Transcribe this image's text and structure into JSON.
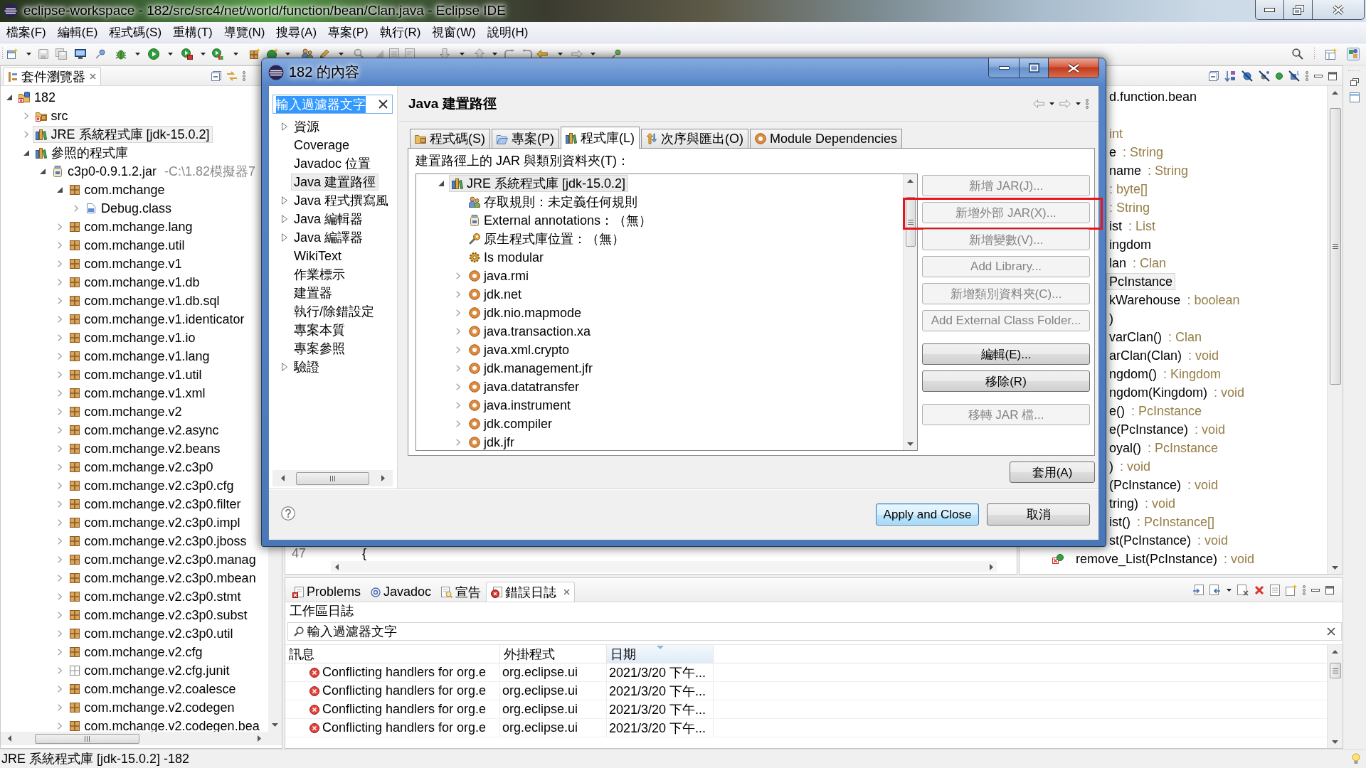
{
  "window": {
    "title": "eclipse-workspace - 182/src/src4/net/world/function/bean/Clan.java - Eclipse IDE"
  },
  "menu_bar": [
    "檔案(F)",
    "編輯(E)",
    "程式碼(S)",
    "重構(T)",
    "導覽(N)",
    "搜尋(A)",
    "專案(P)",
    "執行(R)",
    "視窗(W)",
    "說明(H)"
  ],
  "package_explorer": {
    "title": "套件瀏覽器",
    "tree": [
      {
        "label": "182",
        "kind": "project",
        "expanded": true,
        "selected": false,
        "children": [
          {
            "label": "src",
            "kind": "source-folder",
            "expanded": false,
            "selected": false
          },
          {
            "label": "JRE 系統程式庫 [jdk-15.0.2]",
            "kind": "library",
            "expanded": false,
            "selected": true
          },
          {
            "label": "參照的程式庫",
            "kind": "library",
            "expanded": true,
            "selected": false,
            "children": [
              {
                "label": "c3p0-0.9.1.2.jar",
                "detail": "-C:\\1.82模擬器7",
                "kind": "jar",
                "expanded": true,
                "selected": false,
                "children": [
                  {
                    "label": "com.mchange",
                    "kind": "package",
                    "expanded": true,
                    "selected": false,
                    "children": [
                      {
                        "label": "Debug.class",
                        "kind": "class-file",
                        "expanded": false,
                        "selected": false
                      }
                    ]
                  },
                  {
                    "label": "com.mchange.lang",
                    "kind": "package",
                    "expanded": false,
                    "selected": false
                  },
                  {
                    "label": "com.mchange.util",
                    "kind": "package",
                    "expanded": false,
                    "selected": false
                  },
                  {
                    "label": "com.mchange.v1",
                    "kind": "package",
                    "expanded": false,
                    "selected": false
                  },
                  {
                    "label": "com.mchange.v1.db",
                    "kind": "package",
                    "expanded": false,
                    "selected": false
                  },
                  {
                    "label": "com.mchange.v1.db.sql",
                    "kind": "package",
                    "expanded": false,
                    "selected": false
                  },
                  {
                    "label": "com.mchange.v1.identicator",
                    "kind": "package",
                    "expanded": false,
                    "selected": false
                  },
                  {
                    "label": "com.mchange.v1.io",
                    "kind": "package",
                    "expanded": false,
                    "selected": false
                  },
                  {
                    "label": "com.mchange.v1.lang",
                    "kind": "package",
                    "expanded": false,
                    "selected": false
                  },
                  {
                    "label": "com.mchange.v1.util",
                    "kind": "package",
                    "expanded": false,
                    "selected": false
                  },
                  {
                    "label": "com.mchange.v1.xml",
                    "kind": "package",
                    "expanded": false,
                    "selected": false
                  },
                  {
                    "label": "com.mchange.v2",
                    "kind": "package",
                    "expanded": false,
                    "selected": false
                  },
                  {
                    "label": "com.mchange.v2.async",
                    "kind": "package",
                    "expanded": false,
                    "selected": false
                  },
                  {
                    "label": "com.mchange.v2.beans",
                    "kind": "package",
                    "expanded": false,
                    "selected": false
                  },
                  {
                    "label": "com.mchange.v2.c3p0",
                    "kind": "package",
                    "expanded": false,
                    "selected": false
                  },
                  {
                    "label": "com.mchange.v2.c3p0.cfg",
                    "kind": "package",
                    "expanded": false,
                    "selected": false
                  },
                  {
                    "label": "com.mchange.v2.c3p0.filter",
                    "kind": "package",
                    "expanded": false,
                    "selected": false
                  },
                  {
                    "label": "com.mchange.v2.c3p0.impl",
                    "kind": "package",
                    "expanded": false,
                    "selected": false
                  },
                  {
                    "label": "com.mchange.v2.c3p0.jboss",
                    "kind": "package",
                    "expanded": false,
                    "selected": false
                  },
                  {
                    "label": "com.mchange.v2.c3p0.manag",
                    "kind": "package",
                    "expanded": false,
                    "selected": false
                  },
                  {
                    "label": "com.mchange.v2.c3p0.mbean",
                    "kind": "package",
                    "expanded": false,
                    "selected": false
                  },
                  {
                    "label": "com.mchange.v2.c3p0.stmt",
                    "kind": "package",
                    "expanded": false,
                    "selected": false
                  },
                  {
                    "label": "com.mchange.v2.c3p0.subst",
                    "kind": "package",
                    "expanded": false,
                    "selected": false
                  },
                  {
                    "label": "com.mchange.v2.c3p0.util",
                    "kind": "package",
                    "expanded": false,
                    "selected": false
                  },
                  {
                    "label": "com.mchange.v2.cfg",
                    "kind": "package",
                    "expanded": false,
                    "selected": false
                  },
                  {
                    "label": "com.mchange.v2.cfg.junit",
                    "kind": "empty-package",
                    "expanded": false,
                    "selected": false
                  },
                  {
                    "label": "com.mchange.v2.coalesce",
                    "kind": "package",
                    "expanded": false,
                    "selected": false
                  },
                  {
                    "label": "com.mchange.v2.codegen",
                    "kind": "package",
                    "expanded": false,
                    "selected": false
                  },
                  {
                    "label": "com.mchange.v2.codegen.bea",
                    "kind": "package",
                    "expanded": false,
                    "selected": false
                  }
                ]
              }
            ]
          }
        ]
      }
    ]
  },
  "properties_dialog": {
    "title": "182 的內容",
    "filter": {
      "value": "輸入過濾器文字",
      "value_selected": true
    },
    "categories": [
      {
        "label": "資源",
        "kind": "group",
        "expanded": false,
        "selected": false
      },
      {
        "label": "Coverage",
        "kind": "page",
        "selected": false
      },
      {
        "label": "Javadoc 位置",
        "kind": "page",
        "selected": false
      },
      {
        "label": "Java 建置路徑",
        "kind": "page",
        "selected": true
      },
      {
        "label": "Java 程式撰寫風",
        "kind": "group",
        "expanded": false,
        "selected": false
      },
      {
        "label": "Java 編輯器",
        "kind": "group",
        "expanded": false,
        "selected": false
      },
      {
        "label": "Java 編譯器",
        "kind": "group",
        "expanded": false,
        "selected": false
      },
      {
        "label": "WikiText",
        "kind": "page",
        "selected": false
      },
      {
        "label": "作業標示",
        "kind": "page",
        "selected": false
      },
      {
        "label": "建置器",
        "kind": "page",
        "selected": false
      },
      {
        "label": "執行/除錯設定",
        "kind": "page",
        "selected": false
      },
      {
        "label": "專案本質",
        "kind": "page",
        "selected": false
      },
      {
        "label": "專案參照",
        "kind": "page",
        "selected": false
      },
      {
        "label": "驗證",
        "kind": "group",
        "expanded": false,
        "selected": false
      }
    ],
    "page": {
      "title": "Java 建置路徑",
      "tabs": [
        {
          "label": "程式碼(S)",
          "kind": "source",
          "selected": false
        },
        {
          "label": "專案(P)",
          "kind": "projects",
          "selected": false
        },
        {
          "label": "程式庫(L)",
          "kind": "libraries",
          "selected": true
        },
        {
          "label": "次序與匯出(O)",
          "kind": "order",
          "selected": false
        },
        {
          "label": "Module Dependencies",
          "kind": "modules",
          "selected": false
        }
      ],
      "list_label": "建置路徑上的 JAR 與類別資料夾(T)：",
      "classpath_tree": [
        {
          "label": "JRE 系統程式庫 [jdk-15.0.2]",
          "kind": "library",
          "expanded": true,
          "selected": true,
          "children": [
            {
              "label": "存取規則：未定義任何規則",
              "kind": "access-rules",
              "selected": false
            },
            {
              "label": "External annotations：（無）",
              "kind": "annotations",
              "selected": false
            },
            {
              "label": "原生程式庫位置：（無）",
              "kind": "native-library",
              "selected": false
            },
            {
              "label": "Is modular",
              "kind": "modular",
              "selected": false
            },
            {
              "label": "java.rmi",
              "kind": "module",
              "expanded": false,
              "selected": false
            },
            {
              "label": "jdk.net",
              "kind": "module",
              "expanded": false,
              "selected": false
            },
            {
              "label": "jdk.nio.mapmode",
              "kind": "module",
              "expanded": false,
              "selected": false
            },
            {
              "label": "java.transaction.xa",
              "kind": "module",
              "expanded": false,
              "selected": false
            },
            {
              "label": "java.xml.crypto",
              "kind": "module",
              "expanded": false,
              "selected": false
            },
            {
              "label": "jdk.management.jfr",
              "kind": "module",
              "expanded": false,
              "selected": false
            },
            {
              "label": "java.datatransfer",
              "kind": "module",
              "expanded": false,
              "selected": false
            },
            {
              "label": "java.instrument",
              "kind": "module",
              "expanded": false,
              "selected": false
            },
            {
              "label": "jdk.compiler",
              "kind": "module",
              "expanded": false,
              "selected": false
            },
            {
              "label": "jdk.jfr",
              "kind": "module",
              "expanded": false,
              "selected": false
            }
          ]
        }
      ],
      "button_groups": [
        [
          {
            "label": "新增 JAR(J)...",
            "disabled": true,
            "highlighted": false
          },
          {
            "label": "新增外部 JAR(X)...",
            "disabled": true,
            "highlighted": true
          },
          {
            "label": "新增變數(V)...",
            "disabled": true,
            "highlighted": false
          },
          {
            "label": "Add Library...",
            "disabled": true,
            "highlighted": false
          },
          {
            "label": "新增類別資料夾(C)...",
            "disabled": true,
            "highlighted": false
          },
          {
            "label": "Add External Class Folder...",
            "disabled": true,
            "highlighted": false
          }
        ],
        [
          {
            "label": "編輯(E)...",
            "disabled": false,
            "highlighted": false
          },
          {
            "label": "移除(R)",
            "disabled": false,
            "highlighted": false
          }
        ],
        [
          {
            "label": "移轉 JAR 檔...",
            "disabled": true,
            "highlighted": false
          }
        ]
      ],
      "apply_button": "套用(A)"
    },
    "buttons": [
      {
        "label": "Apply and Close",
        "default": true
      },
      {
        "label": "取消",
        "default": false
      }
    ]
  },
  "editor": {
    "line_number": "47",
    "code": "{"
  },
  "outline": {
    "rows": [
      {
        "kind": "clipped",
        "name": "d.function.bean",
        "selected": false
      },
      {
        "kind": "covered",
        "selected": false
      },
      {
        "kind": "clipped",
        "type": "int",
        "selected": false
      },
      {
        "kind": "clipped",
        "name": "e",
        "type": ": String",
        "selected": false
      },
      {
        "kind": "clipped",
        "name": "name",
        "type": ": String",
        "selected": false
      },
      {
        "kind": "clipped",
        "type": ": byte[]",
        "selected": false
      },
      {
        "kind": "clipped",
        "type": ": String",
        "selected": false
      },
      {
        "kind": "clipped",
        "name": "ist",
        "type": ": List",
        "selected": false
      },
      {
        "kind": "clipped",
        "name": "ingdom",
        "selected": false
      },
      {
        "kind": "clipped",
        "name": "lan",
        "type": ": Clan",
        "selected": false
      },
      {
        "kind": "clipped",
        "name": "PcInstance",
        "selected": true
      },
      {
        "kind": "clipped",
        "name": "kWarehouse",
        "type": ": boolean",
        "selected": false
      },
      {
        "kind": "clipped",
        "name": ")",
        "selected": false
      },
      {
        "kind": "clipped",
        "name": "varClan()",
        "type": ": Clan",
        "selected": false
      },
      {
        "kind": "clipped",
        "name": "arClan(Clan)",
        "type": ": void",
        "selected": false
      },
      {
        "kind": "clipped",
        "name": "ngdom()",
        "type": ": Kingdom",
        "selected": false
      },
      {
        "kind": "clipped",
        "name": "ngdom(Kingdom)",
        "type": ": void",
        "selected": false
      },
      {
        "kind": "clipped",
        "name": "e()",
        "type": ": PcInstance",
        "selected": false
      },
      {
        "kind": "clipped",
        "name": "e(PcInstance)",
        "type": ": void",
        "selected": false
      },
      {
        "kind": "clipped",
        "name": "oyal()",
        "type": ": PcInstance",
        "selected": false
      },
      {
        "kind": "clipped",
        "name": ")",
        "type": ": void",
        "selected": false
      },
      {
        "kind": "clipped",
        "name": "(PcInstance)",
        "type": ": void",
        "selected": false
      },
      {
        "kind": "clipped",
        "name": "tring)",
        "type": ": void",
        "selected": false
      },
      {
        "kind": "clipped",
        "name": "ist()",
        "type": ": PcInstance[]",
        "selected": false
      },
      {
        "kind": "clipped",
        "name": "st(PcInstance)",
        "type": ": void",
        "selected": false
      },
      {
        "kind": "method",
        "name": "remove_List(PcInstance)",
        "type": ": void",
        "selected": false
      }
    ]
  },
  "log_view": {
    "tabs": [
      {
        "label": "Problems",
        "kind": "problems",
        "selected": false
      },
      {
        "label": "Javadoc",
        "kind": "javadoc",
        "selected": false
      },
      {
        "label": "宣告",
        "kind": "declaration",
        "selected": false
      },
      {
        "label": "錯誤日誌",
        "kind": "error-log",
        "selected": true
      }
    ],
    "title": "工作區日誌",
    "filter": {
      "value": "輸入過濾器文字"
    },
    "table": {
      "columns": [
        {
          "label": "訊息",
          "sorted": false
        },
        {
          "label": "外掛程式",
          "sorted": false
        },
        {
          "label": "日期",
          "sorted": true
        }
      ],
      "rows": [
        {
          "kind": "error",
          "message": "Conflicting handlers for org.e",
          "plugin": "org.eclipse.ui",
          "date": "2021/3/20 下午..."
        },
        {
          "kind": "error",
          "message": "Conflicting handlers for org.e",
          "plugin": "org.eclipse.ui",
          "date": "2021/3/20 下午..."
        },
        {
          "kind": "error",
          "message": "Conflicting handlers for org.e",
          "plugin": "org.eclipse.ui",
          "date": "2021/3/20 下午..."
        },
        {
          "kind": "error",
          "message": "Conflicting handlers for org.e",
          "plugin": "org.eclipse.ui",
          "date": "2021/3/20 下午..."
        }
      ]
    }
  },
  "status_bar": {
    "text": "JRE 系統程式庫 [jdk-15.0.2] -182"
  }
}
